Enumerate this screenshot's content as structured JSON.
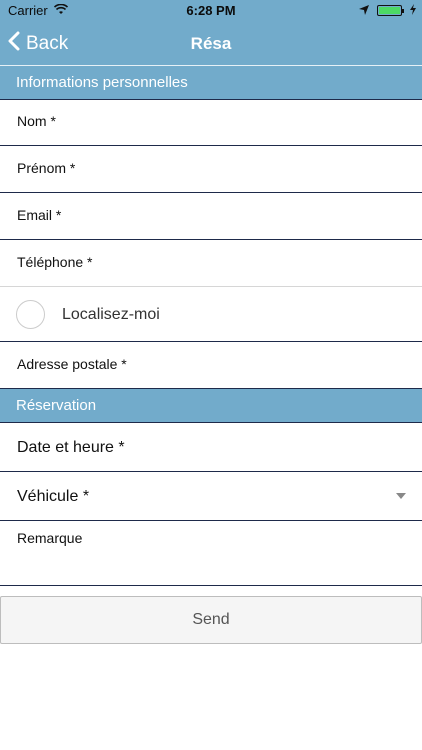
{
  "status_bar": {
    "carrier": "Carrier",
    "time": "6:28 PM",
    "wifi_icon": "wifi-icon",
    "location_icon": "location-arrow-icon",
    "charging_icon": "charging-bolt-icon",
    "battery_color": "#4cd964"
  },
  "nav": {
    "back_label": "Back",
    "back_icon": "chevron-left-icon",
    "title": "Résa",
    "background_color": "#72abcb"
  },
  "personal_section": {
    "header": "Informations personnelles",
    "fields": {
      "nom": "Nom *",
      "prenom": "Prénom *",
      "email": "Email *",
      "telephone": "Téléphone *",
      "localize": "Localisez-moi",
      "adresse": "Adresse postale *"
    }
  },
  "reservation_section": {
    "header": "Réservation",
    "fields": {
      "date": "Date et heure *",
      "vehicule": "Véhicule *",
      "remarque": "Remarque"
    },
    "dropdown_icon": "dropdown-arrow-icon"
  },
  "actions": {
    "send": "Send"
  }
}
